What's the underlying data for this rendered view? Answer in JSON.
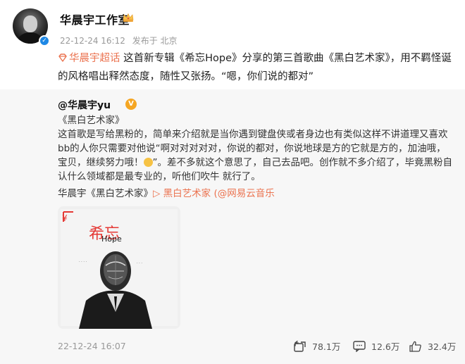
{
  "post": {
    "author": "华晨宇工作室",
    "time": "22-12-24 16:12",
    "location": "发布于 北京",
    "topic": "华晨宇超话",
    "text": "这首新专辑《希忘Hope》分享的第三首歌曲《黑白艺术家》，用不羁怪诞的风格唱出释然态度，随性又张扬。“嗯，你们说的都对”"
  },
  "repost": {
    "author": "@华晨宇yu",
    "title_line": "《黑白艺术家》",
    "para1": "这首歌是写给黑粉的，简单来介绍就是当你遇到键盘侠或者身边也有类似这样不讲道理又喜欢bb的人你只需要对他说“啊对对对对对，你说的都对，你说地球是方的它就是方的，加油哦，宝贝，继续努力哦！",
    "para2": "”。差不多就这个意思了，自己去品吧。创作就不多介绍了，毕竟黑粉自认什么领域都是最专业的，听他们吹牛 就行了。",
    "music_prefix": "华晨宇《黑白艺术家》",
    "music_link": "▷ 黑白艺术家",
    "music_source": "(@网易云音乐",
    "cover": {
      "album_title": "希忘",
      "album_sub": "Hope"
    },
    "time": "22-12-24 16:07",
    "reposts": "78.1万",
    "comments": "12.6万",
    "likes": "32.4万"
  },
  "colors": {
    "accent": "#eb7350",
    "verified": "#1e88e5",
    "badge": "#f5a623"
  },
  "icons": [
    "verified-icon",
    "crown-icon",
    "topic-diamond-icon",
    "v-badge-icon",
    "smile-emoji-icon",
    "repost-icon",
    "comment-icon",
    "like-icon"
  ]
}
